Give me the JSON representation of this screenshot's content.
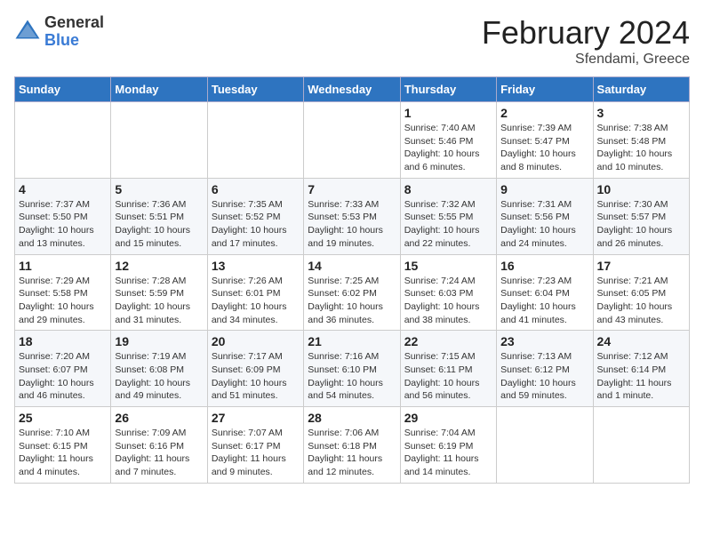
{
  "header": {
    "logo_general": "General",
    "logo_blue": "Blue",
    "month_title": "February 2024",
    "location": "Sfendami, Greece"
  },
  "days_of_week": [
    "Sunday",
    "Monday",
    "Tuesday",
    "Wednesday",
    "Thursday",
    "Friday",
    "Saturday"
  ],
  "weeks": [
    [
      {
        "day": "",
        "empty": true
      },
      {
        "day": "",
        "empty": true
      },
      {
        "day": "",
        "empty": true
      },
      {
        "day": "",
        "empty": true
      },
      {
        "day": "1",
        "sunrise": "Sunrise: 7:40 AM",
        "sunset": "Sunset: 5:46 PM",
        "daylight": "Daylight: 10 hours and 6 minutes."
      },
      {
        "day": "2",
        "sunrise": "Sunrise: 7:39 AM",
        "sunset": "Sunset: 5:47 PM",
        "daylight": "Daylight: 10 hours and 8 minutes."
      },
      {
        "day": "3",
        "sunrise": "Sunrise: 7:38 AM",
        "sunset": "Sunset: 5:48 PM",
        "daylight": "Daylight: 10 hours and 10 minutes."
      }
    ],
    [
      {
        "day": "4",
        "sunrise": "Sunrise: 7:37 AM",
        "sunset": "Sunset: 5:50 PM",
        "daylight": "Daylight: 10 hours and 13 minutes."
      },
      {
        "day": "5",
        "sunrise": "Sunrise: 7:36 AM",
        "sunset": "Sunset: 5:51 PM",
        "daylight": "Daylight: 10 hours and 15 minutes."
      },
      {
        "day": "6",
        "sunrise": "Sunrise: 7:35 AM",
        "sunset": "Sunset: 5:52 PM",
        "daylight": "Daylight: 10 hours and 17 minutes."
      },
      {
        "day": "7",
        "sunrise": "Sunrise: 7:33 AM",
        "sunset": "Sunset: 5:53 PM",
        "daylight": "Daylight: 10 hours and 19 minutes."
      },
      {
        "day": "8",
        "sunrise": "Sunrise: 7:32 AM",
        "sunset": "Sunset: 5:55 PM",
        "daylight": "Daylight: 10 hours and 22 minutes."
      },
      {
        "day": "9",
        "sunrise": "Sunrise: 7:31 AM",
        "sunset": "Sunset: 5:56 PM",
        "daylight": "Daylight: 10 hours and 24 minutes."
      },
      {
        "day": "10",
        "sunrise": "Sunrise: 7:30 AM",
        "sunset": "Sunset: 5:57 PM",
        "daylight": "Daylight: 10 hours and 26 minutes."
      }
    ],
    [
      {
        "day": "11",
        "sunrise": "Sunrise: 7:29 AM",
        "sunset": "Sunset: 5:58 PM",
        "daylight": "Daylight: 10 hours and 29 minutes."
      },
      {
        "day": "12",
        "sunrise": "Sunrise: 7:28 AM",
        "sunset": "Sunset: 5:59 PM",
        "daylight": "Daylight: 10 hours and 31 minutes."
      },
      {
        "day": "13",
        "sunrise": "Sunrise: 7:26 AM",
        "sunset": "Sunset: 6:01 PM",
        "daylight": "Daylight: 10 hours and 34 minutes."
      },
      {
        "day": "14",
        "sunrise": "Sunrise: 7:25 AM",
        "sunset": "Sunset: 6:02 PM",
        "daylight": "Daylight: 10 hours and 36 minutes."
      },
      {
        "day": "15",
        "sunrise": "Sunrise: 7:24 AM",
        "sunset": "Sunset: 6:03 PM",
        "daylight": "Daylight: 10 hours and 38 minutes."
      },
      {
        "day": "16",
        "sunrise": "Sunrise: 7:23 AM",
        "sunset": "Sunset: 6:04 PM",
        "daylight": "Daylight: 10 hours and 41 minutes."
      },
      {
        "day": "17",
        "sunrise": "Sunrise: 7:21 AM",
        "sunset": "Sunset: 6:05 PM",
        "daylight": "Daylight: 10 hours and 43 minutes."
      }
    ],
    [
      {
        "day": "18",
        "sunrise": "Sunrise: 7:20 AM",
        "sunset": "Sunset: 6:07 PM",
        "daylight": "Daylight: 10 hours and 46 minutes."
      },
      {
        "day": "19",
        "sunrise": "Sunrise: 7:19 AM",
        "sunset": "Sunset: 6:08 PM",
        "daylight": "Daylight: 10 hours and 49 minutes."
      },
      {
        "day": "20",
        "sunrise": "Sunrise: 7:17 AM",
        "sunset": "Sunset: 6:09 PM",
        "daylight": "Daylight: 10 hours and 51 minutes."
      },
      {
        "day": "21",
        "sunrise": "Sunrise: 7:16 AM",
        "sunset": "Sunset: 6:10 PM",
        "daylight": "Daylight: 10 hours and 54 minutes."
      },
      {
        "day": "22",
        "sunrise": "Sunrise: 7:15 AM",
        "sunset": "Sunset: 6:11 PM",
        "daylight": "Daylight: 10 hours and 56 minutes."
      },
      {
        "day": "23",
        "sunrise": "Sunrise: 7:13 AM",
        "sunset": "Sunset: 6:12 PM",
        "daylight": "Daylight: 10 hours and 59 minutes."
      },
      {
        "day": "24",
        "sunrise": "Sunrise: 7:12 AM",
        "sunset": "Sunset: 6:14 PM",
        "daylight": "Daylight: 11 hours and 1 minute."
      }
    ],
    [
      {
        "day": "25",
        "sunrise": "Sunrise: 7:10 AM",
        "sunset": "Sunset: 6:15 PM",
        "daylight": "Daylight: 11 hours and 4 minutes."
      },
      {
        "day": "26",
        "sunrise": "Sunrise: 7:09 AM",
        "sunset": "Sunset: 6:16 PM",
        "daylight": "Daylight: 11 hours and 7 minutes."
      },
      {
        "day": "27",
        "sunrise": "Sunrise: 7:07 AM",
        "sunset": "Sunset: 6:17 PM",
        "daylight": "Daylight: 11 hours and 9 minutes."
      },
      {
        "day": "28",
        "sunrise": "Sunrise: 7:06 AM",
        "sunset": "Sunset: 6:18 PM",
        "daylight": "Daylight: 11 hours and 12 minutes."
      },
      {
        "day": "29",
        "sunrise": "Sunrise: 7:04 AM",
        "sunset": "Sunset: 6:19 PM",
        "daylight": "Daylight: 11 hours and 14 minutes."
      },
      {
        "day": "",
        "empty": true
      },
      {
        "day": "",
        "empty": true
      }
    ]
  ]
}
